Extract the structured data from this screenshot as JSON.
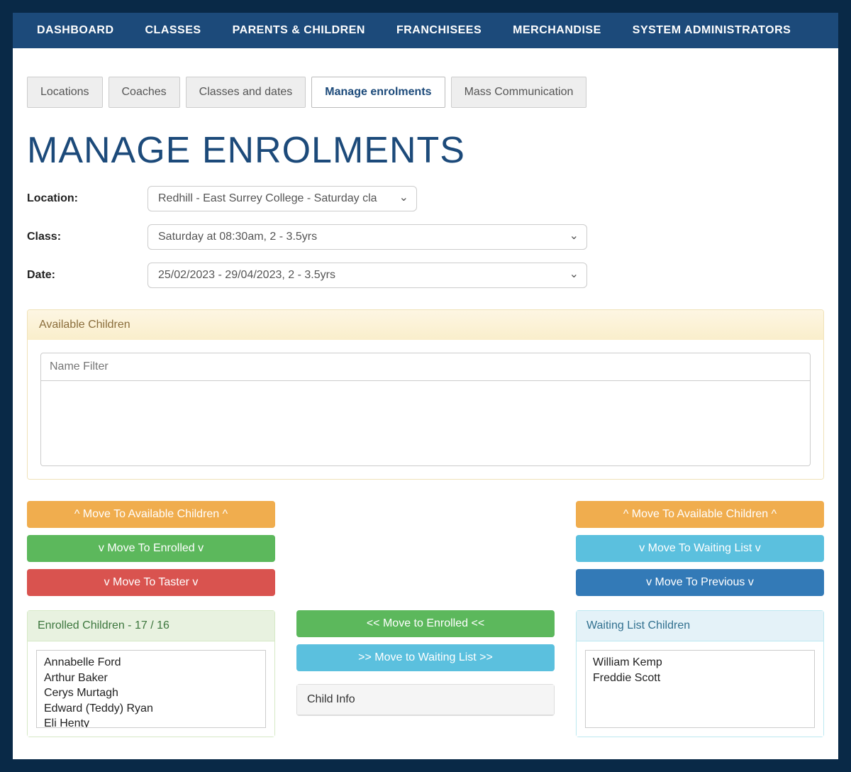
{
  "topnav": [
    "DASHBOARD",
    "CLASSES",
    "PARENTS & CHILDREN",
    "FRANCHISEES",
    "MERCHANDISE",
    "SYSTEM ADMINISTRATORS"
  ],
  "tabs": [
    {
      "label": "Locations",
      "active": false
    },
    {
      "label": "Coaches",
      "active": false
    },
    {
      "label": "Classes and dates",
      "active": false
    },
    {
      "label": "Manage enrolments",
      "active": true
    },
    {
      "label": "Mass Communication",
      "active": false
    }
  ],
  "page_title": "MANAGE ENROLMENTS",
  "form": {
    "location_label": "Location:",
    "location_value": "Redhill - East Surrey College - Saturday cla",
    "class_label": "Class:",
    "class_value": "Saturday at 08:30am, 2 - 3.5yrs",
    "date_label": "Date:",
    "date_value": "25/02/2023 - 29/04/2023, 2 - 3.5yrs"
  },
  "available_panel": {
    "title": "Available Children",
    "filter_placeholder": "Name Filter"
  },
  "left_actions": {
    "to_available": "^ Move To Available Children ^",
    "to_enrolled": "v Move To Enrolled v",
    "to_taster": "v Move To Taster v"
  },
  "right_actions": {
    "to_available": "^ Move To Available Children ^",
    "to_waiting": "v Move To Waiting List v",
    "to_previous": "v Move To Previous v"
  },
  "center_actions": {
    "to_enrolled": "<< Move to Enrolled <<",
    "to_waiting": ">> Move to Waiting List >>"
  },
  "enrolled_panel": {
    "title": "Enrolled Children - 17 / 16",
    "children": [
      "Annabelle Ford",
      "Arthur Baker",
      "Cerys Murtagh",
      "Edward (Teddy) Ryan",
      "Eli Henty"
    ]
  },
  "waiting_panel": {
    "title": "Waiting List Children",
    "children": [
      "William Kemp",
      "Freddie Scott"
    ]
  },
  "child_info_panel": {
    "title": "Child Info"
  }
}
